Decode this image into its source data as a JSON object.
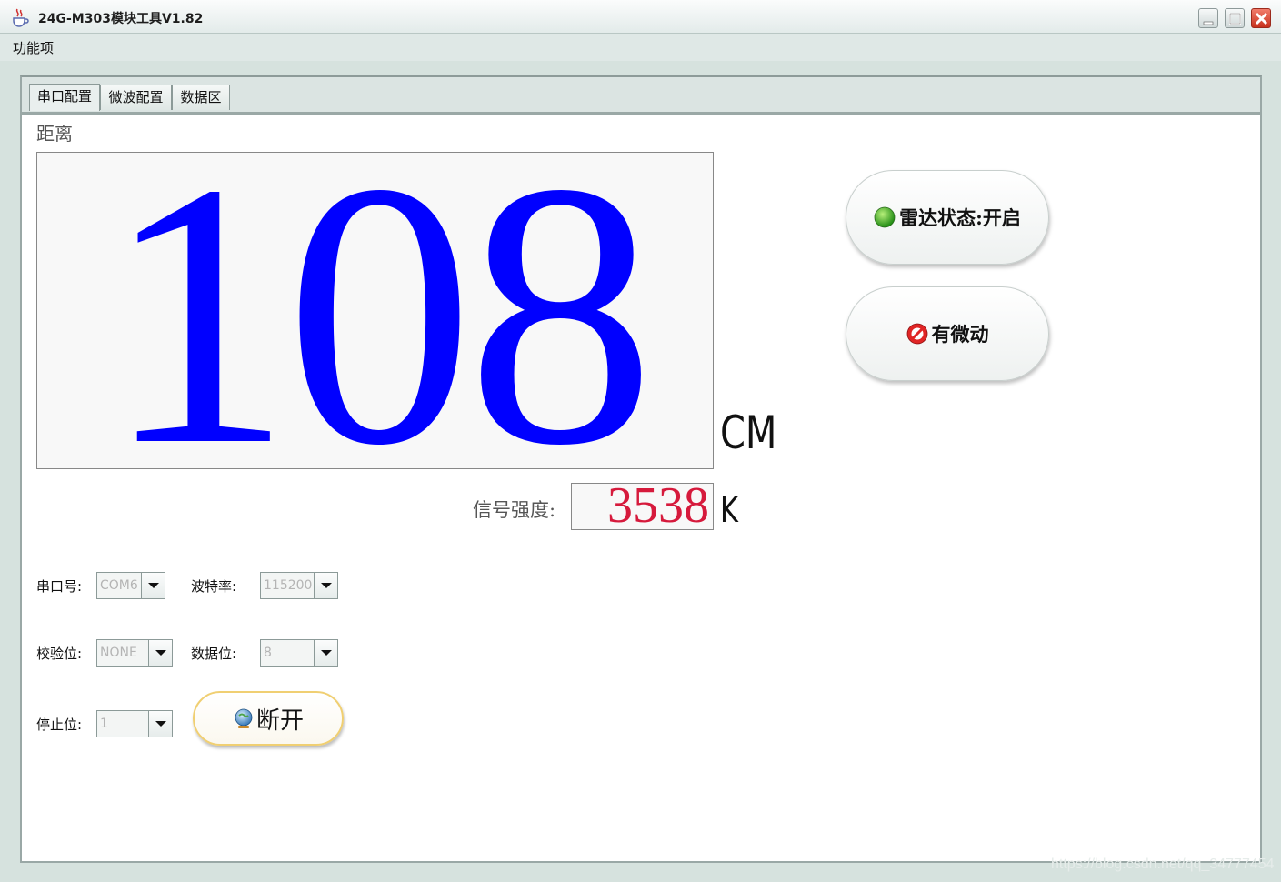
{
  "window": {
    "title": "24G-M303模块工具V1.82"
  },
  "menu": {
    "items": [
      "功能项"
    ]
  },
  "tabs": [
    {
      "label": "串口配置",
      "active": true
    },
    {
      "label": "微波配置",
      "active": false
    },
    {
      "label": "数据区",
      "active": false
    }
  ],
  "distance": {
    "label": "距离",
    "value": "108",
    "unit": "CM",
    "value_color": "#0000ff"
  },
  "signal": {
    "label": "信号强度:",
    "value": "3538",
    "unit": "K",
    "value_color": "#d61a3c"
  },
  "status_buttons": {
    "radar": {
      "label": "雷达状态:开启",
      "icon": "green-dot-icon"
    },
    "motion": {
      "label": "有微动",
      "icon": "red-stop-icon"
    }
  },
  "serial_settings": {
    "port": {
      "label": "串口号:",
      "value": "COM6"
    },
    "baud": {
      "label": "波特率:",
      "value": "115200"
    },
    "parity": {
      "label": "校验位:",
      "value": "NONE"
    },
    "databits": {
      "label": "数据位:",
      "value": "8"
    },
    "stopbits": {
      "label": "停止位:",
      "value": "1"
    }
  },
  "connect_button": {
    "label": "断开",
    "icon": "globe-icon"
  },
  "watermark": "https://blog.csdn.net/qq_34777454"
}
